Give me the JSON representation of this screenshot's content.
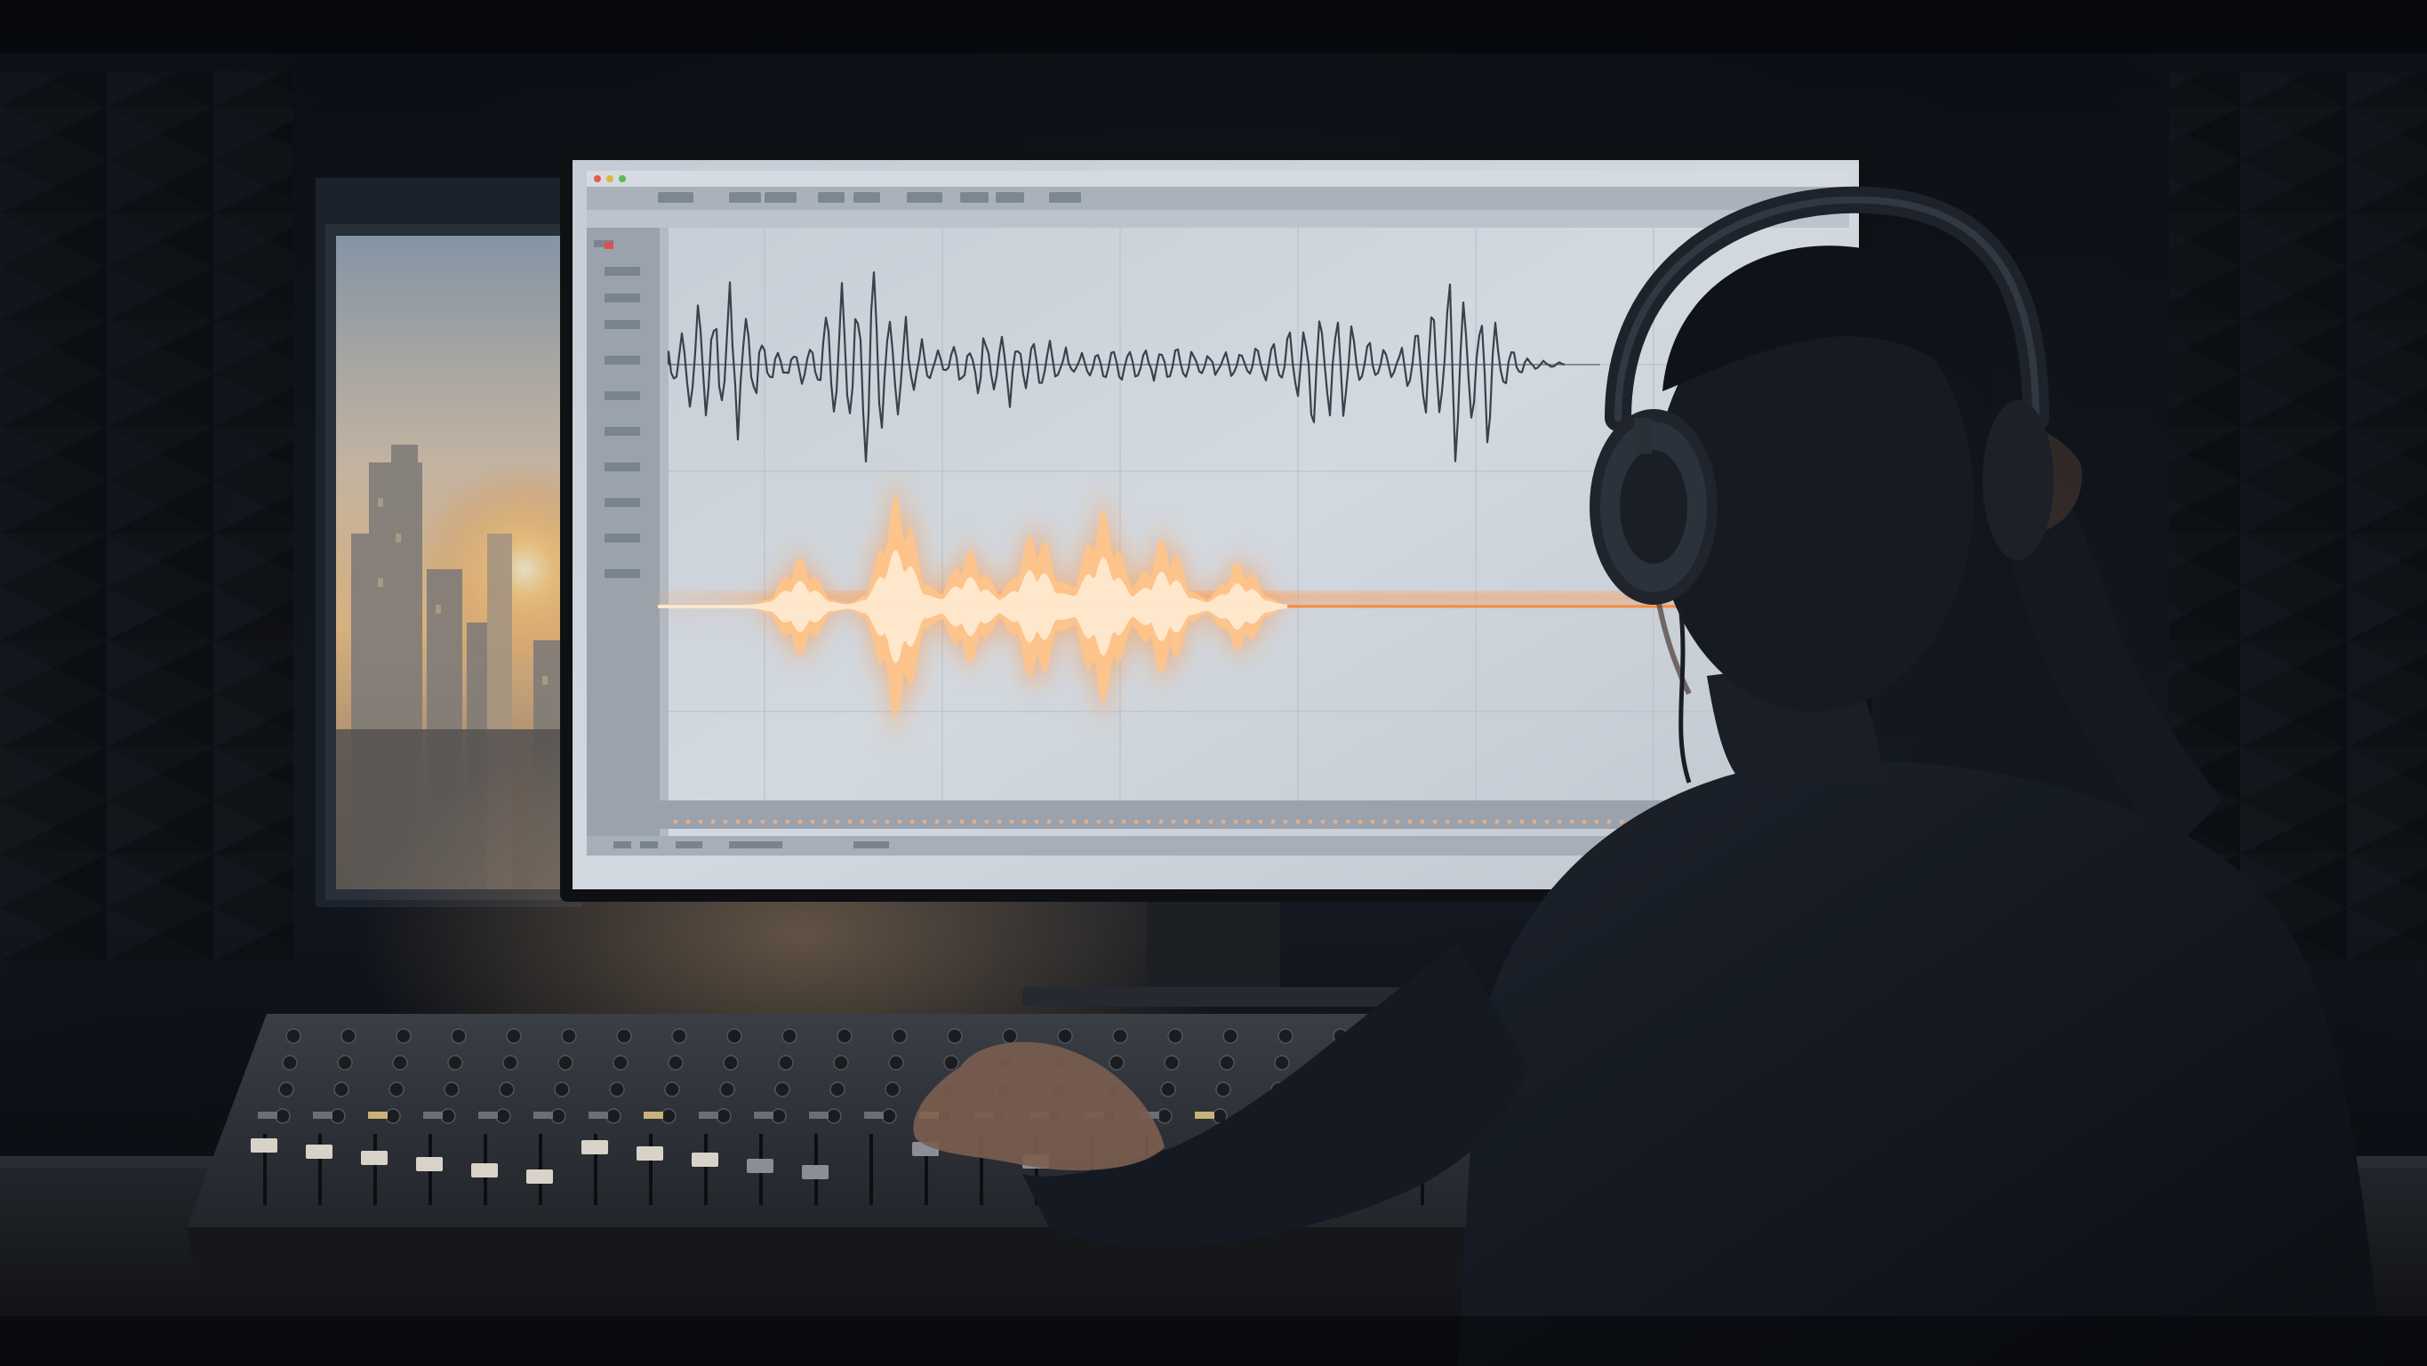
{
  "scene": {
    "description_tags": [
      "studio-room",
      "computer-monitor",
      "audio-editor",
      "mixing-console",
      "person-with-headphones",
      "window-sunset"
    ],
    "colors": {
      "room": "#10141b",
      "foam": "#1a1f27",
      "screen_bg": "#c9d0d8",
      "screen_panel": "#aeb6c0",
      "wave_dark": "#3a414b",
      "wave_glow": "#ffb070",
      "wave_core": "#ffe3c0",
      "sunset": "#f3c48a",
      "console": "#2b2f35",
      "desk": "#1a1c20",
      "silhouette": "#12161d"
    },
    "icons": {
      "window_controls": [
        "close-dot",
        "minimize-dot",
        "zoom-dot"
      ],
      "headphones": "headphones-icon"
    }
  }
}
